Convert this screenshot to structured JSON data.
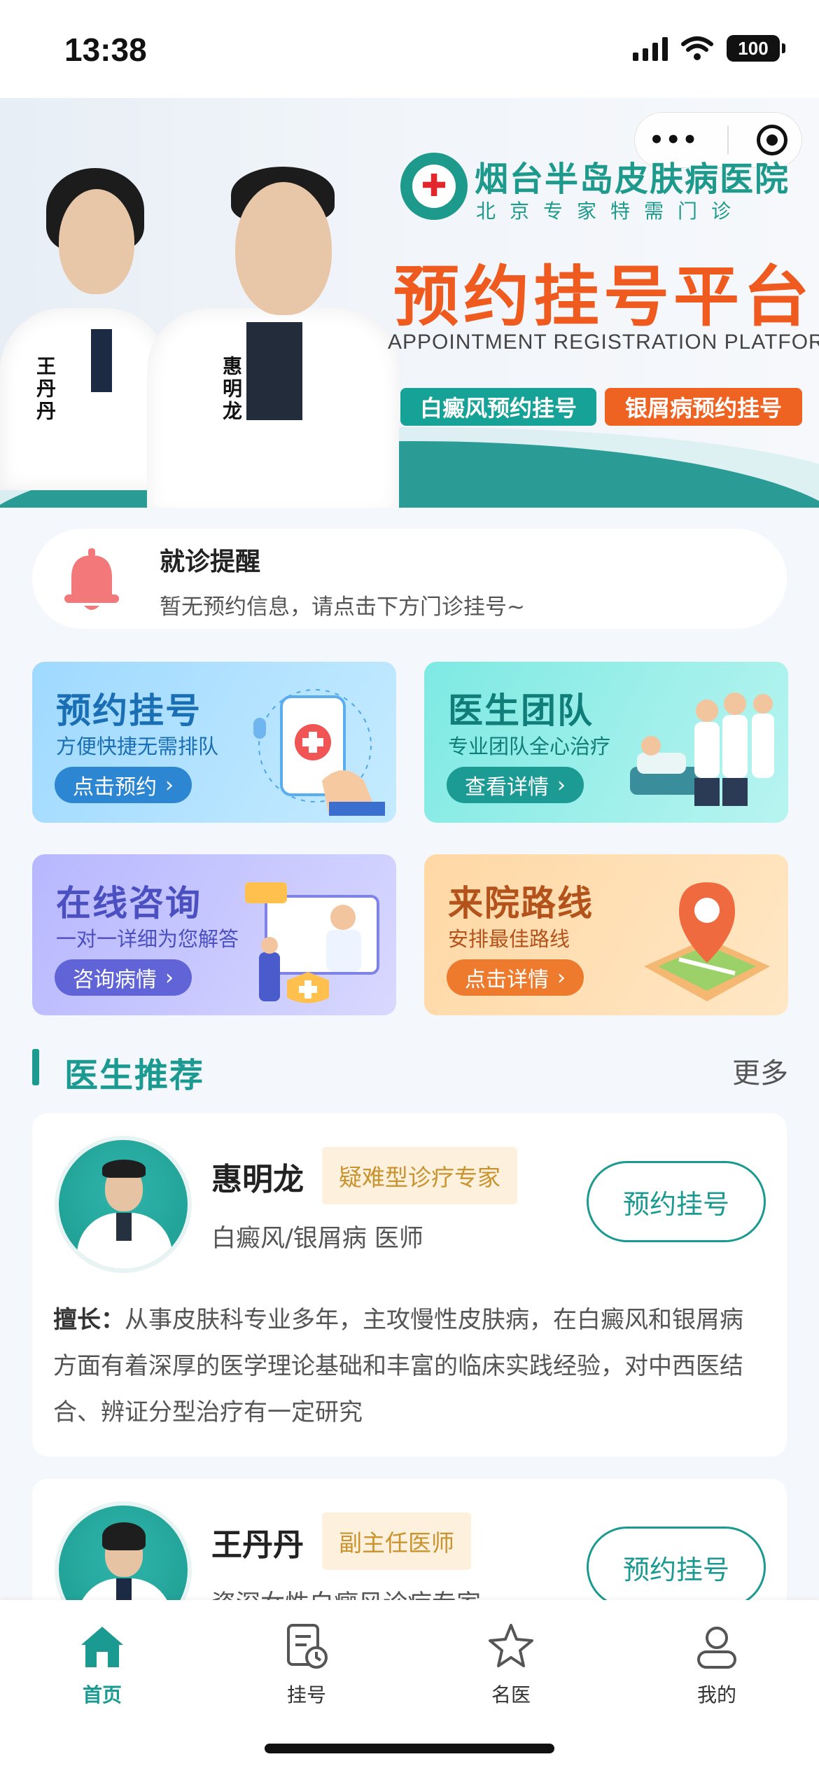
{
  "status_bar": {
    "time": "13:38",
    "battery": "100"
  },
  "banner": {
    "hospital_name": "烟台半岛皮肤病医院",
    "hospital_subtitle": "北京专家特需门诊",
    "title": "预约挂号平台",
    "title_en": "APPOINTMENT REGISTRATION PLATFORM",
    "doctor_left_name": "王丹丹",
    "doctor_right_name": "惠明龙",
    "tag_vitiligo": "白癜风预约挂号",
    "tag_psoriasis": "银屑病预约挂号"
  },
  "reminder": {
    "title": "就诊提醒",
    "text": "暂无预约信息，请点击下方门诊挂号~"
  },
  "features": [
    {
      "title": "预约挂号",
      "subtitle": "方便快捷无需排队",
      "button": "点击预约"
    },
    {
      "title": "医生团队",
      "subtitle": "专业团队全心治疗",
      "button": "查看详情"
    },
    {
      "title": "在线咨询",
      "subtitle": "一对一详细为您解答",
      "button": "咨询病情"
    },
    {
      "title": "来院路线",
      "subtitle": "安排最佳路线",
      "button": "点击详情"
    }
  ],
  "section": {
    "title": "医生推荐",
    "more": "更多"
  },
  "doctors": [
    {
      "name": "惠明龙",
      "badge": "疑难型诊疗专家",
      "dept": "白癜风/银屑病  医师",
      "book": "预约挂号",
      "desc_label": "擅长：",
      "desc": "从事皮肤科专业多年，主攻慢性皮肤病，在白癜风和银屑病方面有着深厚的医学理论基础和丰富的临床实践经验，对中西医结合、辨证分型治疗有一定研究"
    },
    {
      "name": "王丹丹",
      "badge": "副主任医师",
      "dept": "资深女性白癜风诊疗专家",
      "book": "预约挂号"
    }
  ],
  "tabs": [
    {
      "label": "首页",
      "icon": "home-icon"
    },
    {
      "label": "挂号",
      "icon": "register-icon"
    },
    {
      "label": "名医",
      "icon": "star-icon"
    },
    {
      "label": "我的",
      "icon": "user-icon"
    }
  ],
  "colors": {
    "primary": "#1a9a90",
    "orange": "#ef5a1f"
  }
}
